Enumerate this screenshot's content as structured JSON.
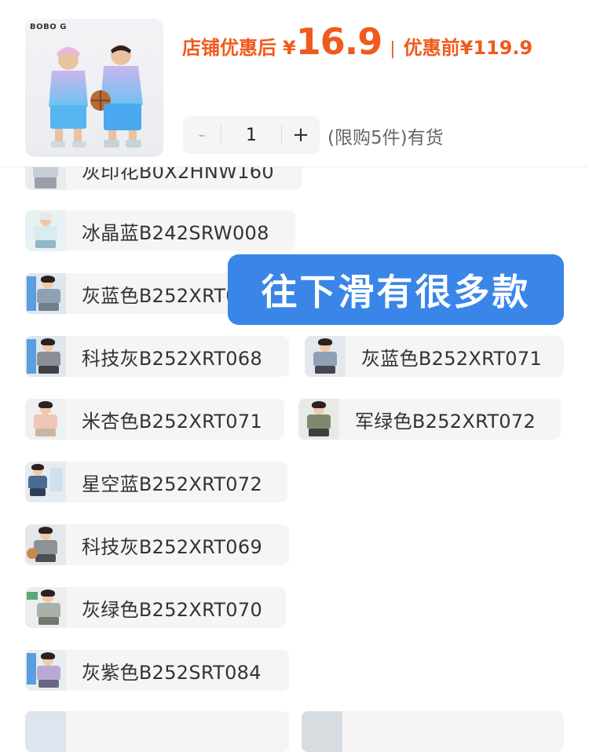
{
  "header": {
    "brand_logo": "BOBO G",
    "price_label": "店铺优惠后",
    "price_currency": "¥",
    "price_value": "16.9",
    "separator": "|",
    "original_label": "优惠前",
    "original_price": "¥119.9",
    "quantity": {
      "minus": "-",
      "value": "1",
      "plus": "+"
    },
    "stock_text": "(限购5件)有货",
    "accent_color": "#f05a1c"
  },
  "banner": {
    "text": "往下滑有很多款",
    "color": "#3a86e8"
  },
  "variants": [
    {
      "label": "灰印花B0X2HNW160"
    },
    {
      "label": "冰晶蓝B242SRW008"
    },
    {
      "label": "灰蓝色B252XRT0"
    },
    {
      "label": "科技灰B252XRT068"
    },
    {
      "label": "灰蓝色B252XRT071"
    },
    {
      "label": "米杏色B252XRT071"
    },
    {
      "label": "军绿色B252XRT072"
    },
    {
      "label": "星空蓝B252XRT072"
    },
    {
      "label": "科技灰B252XRT069"
    },
    {
      "label": "灰绿色B252XRT070"
    },
    {
      "label": "灰紫色B252SRT084"
    },
    {
      "label": ""
    },
    {
      "label": ""
    }
  ]
}
